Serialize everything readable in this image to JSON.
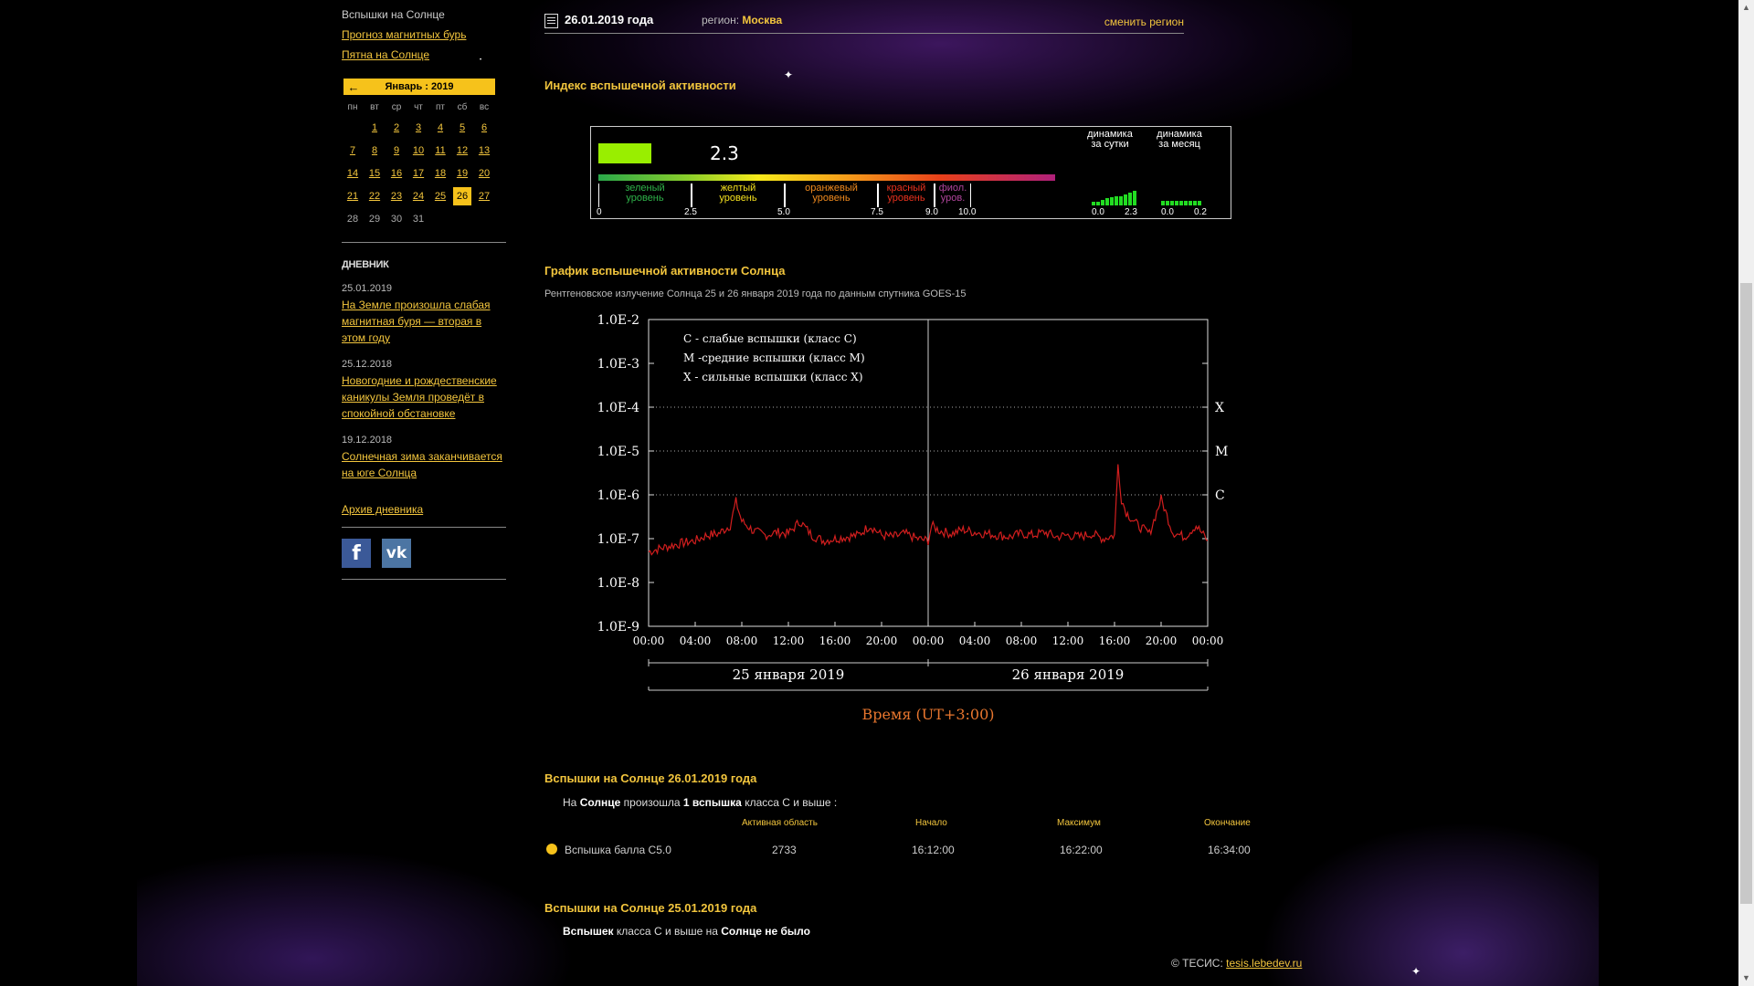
{
  "sidebar": {
    "items": [
      {
        "label": "Вспышки на Солнце",
        "link": false
      },
      {
        "label": "Прогноз магнитных бурь",
        "link": true
      },
      {
        "label": "Пятна на Солнце",
        "link": true
      }
    ],
    "calendar": {
      "prev_arrow": "←",
      "title": "Январь : 2019",
      "weekdays": [
        "пн",
        "вт",
        "ср",
        "чт",
        "пт",
        "сб",
        "вс"
      ],
      "offset": 1,
      "days": [
        "1",
        "2",
        "3",
        "4",
        "5",
        "6",
        "7",
        "8",
        "9",
        "10",
        "11",
        "12",
        "13",
        "14",
        "15",
        "16",
        "17",
        "18",
        "19",
        "20",
        "21",
        "22",
        "23",
        "24",
        "25",
        "26",
        "27",
        "28",
        "29",
        "30",
        "31"
      ],
      "today": "26",
      "last_linked_day": 27
    },
    "diary": {
      "title": "ДНЕВНИК",
      "entries": [
        {
          "date": "25.01.2019",
          "text": "На Земле произошла слабая магнитная буря — вторая в этом году"
        },
        {
          "date": "25.12.2018",
          "text": "Новогодние и рождественские каникулы Земля проведёт в спокойной обстановке"
        },
        {
          "date": "19.12.2018",
          "text": "Солнечная зима заканчивается на юге Солнца"
        }
      ],
      "archive": "Архив дневника"
    },
    "social": [
      {
        "name": "facebook-icon",
        "glyph": "f"
      },
      {
        "name": "vk-icon",
        "glyph": "vk"
      }
    ]
  },
  "top": {
    "date": "26.01.2019 года",
    "region_label": "регион:",
    "region": "Москва",
    "change_region": "сменить регион"
  },
  "index": {
    "heading": "Индекс вспышечной активности",
    "value": "2.3",
    "value_num": 2.3,
    "levels": [
      {
        "label1": "зеленый",
        "label2": "уровень",
        "color": "#2fb34a"
      },
      {
        "label1": "желтый",
        "label2": "уровень",
        "color": "#f5e11e"
      },
      {
        "label1": "оранжевый",
        "label2": "уровень",
        "color": "#f08a1e"
      },
      {
        "label1": "красный",
        "label2": "уровень",
        "color": "#e8321e"
      },
      {
        "label1": "фиол.",
        "label2": "уров.",
        "color": "#b0459c"
      }
    ],
    "ticks": [
      "0",
      "2.5",
      "5.0",
      "7.5",
      "9.0",
      "10.0"
    ],
    "dynamics_day": {
      "title1": "динамика",
      "title2": "за сутки",
      "min": "0.0",
      "max": "2.3"
    },
    "dynamics_month": {
      "title1": "динамика",
      "title2": "за месяц",
      "min": "0.0",
      "max": "0.2"
    }
  },
  "chart": {
    "heading": "График вспышечной активности Солнца",
    "subtitle": "Рентгеновское излучение Солнца 25 и 26 января 2019 года по данным спутника GOES-15"
  },
  "chart_data": {
    "type": "line",
    "title": "",
    "xlabel": "Время (UT+3:00)",
    "ylabel": "",
    "yscale": "log",
    "ylim": [
      "1.0E-9",
      "1.0E-2"
    ],
    "y_ticks": [
      "1.0E-2",
      "1.0E-3",
      "1.0E-4",
      "1.0E-5",
      "1.0E-6",
      "1.0E-7",
      "1.0E-8",
      "1.0E-9"
    ],
    "x_ticks": [
      "00:00",
      "04:00",
      "08:00",
      "12:00",
      "16:00",
      "20:00",
      "00:00",
      "04:00",
      "08:00",
      "12:00",
      "16:00",
      "20:00",
      "00:00"
    ],
    "day_labels": [
      "25 января 2019",
      "26 января 2019"
    ],
    "class_labels": [
      "X",
      "M",
      "C"
    ],
    "legend": [
      "С - слабые вспышки (класс С)",
      "М -средние вспышки (класс М)",
      "Х - сильные вспышки (класс Х)"
    ],
    "color": "#d21e1e",
    "series": [
      {
        "x_hours": [
          0,
          1,
          2,
          3,
          4,
          5,
          6,
          7,
          7.5,
          8,
          9,
          10,
          11,
          12,
          13,
          14,
          15,
          16,
          17,
          18,
          19,
          20,
          21,
          22,
          23,
          24,
          24.3,
          25,
          26,
          27,
          28,
          29,
          30,
          31,
          32,
          33,
          34,
          35,
          36,
          37,
          38,
          39,
          40,
          40.3,
          40.6,
          41,
          42,
          43,
          44,
          45,
          46,
          47,
          48
        ],
        "values": [
          5e-08,
          6e-08,
          7e-08,
          8e-08,
          9e-08,
          1.2e-07,
          1.3e-07,
          2e-07,
          7e-07,
          2.5e-07,
          1.5e-07,
          1.2e-07,
          1.4e-07,
          1.3e-07,
          2.5e-07,
          1.2e-07,
          9e-08,
          1e-07,
          1.1e-07,
          1.2e-07,
          2e-07,
          1.2e-07,
          1.1e-07,
          1.3e-07,
          1e-07,
          9e-08,
          2e-07,
          1.5e-07,
          1.3e-07,
          1.6e-07,
          1.4e-07,
          1.3e-07,
          1.2e-07,
          1.1e-07,
          1.3e-07,
          1.2e-07,
          1.4e-07,
          1.1e-07,
          1.2e-07,
          1.1e-07,
          1.3e-07,
          1e-07,
          1.2e-07,
          5e-06,
          8e-07,
          4e-07,
          2e-07,
          1.3e-07,
          8e-07,
          1.4e-07,
          1.1e-07,
          2e-07,
          9e-08
        ]
      }
    ]
  },
  "flares_today": {
    "heading": "Вспышки на Солнце 26.01.2019 года",
    "intro": {
      "p1": "На",
      "b1": "Солнце",
      "p2": "произошла",
      "b2": "1 вспышка",
      "p3": "класса С и выше :"
    },
    "columns": [
      "Активная область",
      "Начало",
      "Максимум",
      "Окончание"
    ],
    "rows": [
      {
        "name": "Вспышка балла C5.0",
        "region": "2733",
        "start": "16:12:00",
        "max": "16:22:00",
        "end": "16:34:00"
      }
    ]
  },
  "flares_yesterday": {
    "heading": "Вспышки на Солнце 25.01.2019 года",
    "intro": {
      "b1": "Вспышек",
      "p1": "класса С и выше на",
      "b2": "Солнце не было"
    }
  },
  "footer": {
    "copy": "© ТЕСИС:",
    "link": "tesis.lebedev.ru"
  },
  "scrollbar": {
    "up": "▲",
    "down": "▼"
  }
}
